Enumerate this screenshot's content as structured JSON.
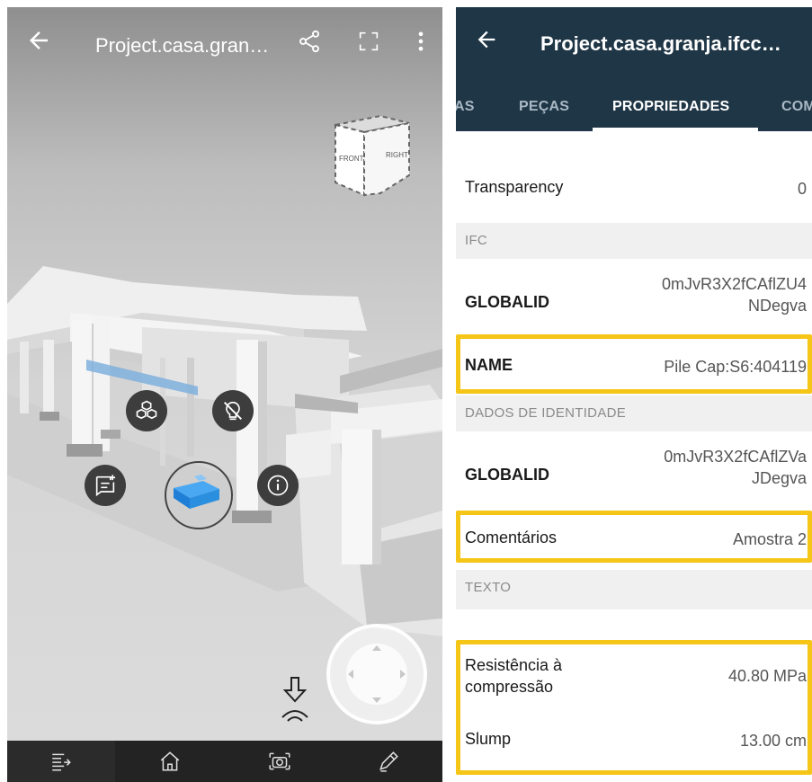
{
  "viewer": {
    "title": "Project.casa.gran…",
    "icons": [
      "back-arrow-icon",
      "share-icon",
      "fullscreen-icon",
      "more-vert-icon"
    ],
    "view_cube": {
      "front": "FRONT",
      "right": "RIGHT"
    },
    "actions": [
      "isolate-icon",
      "hide-icon",
      "comment-icon",
      "info-icon"
    ],
    "bottom_bar": [
      "tree-list-icon",
      "home-icon",
      "camera-icon",
      "pencil-icon"
    ],
    "accent_selected": "#2b8fe0"
  },
  "panel": {
    "title": "Project.casa.granja.ifcc…",
    "tabs": [
      "AS",
      "PEÇAS",
      "PROPRIEDADES",
      "COM"
    ],
    "active_tab": "PROPRIEDADES",
    "header_bg": "#1f3646",
    "highlight_color": "#f5c518",
    "rows": {
      "transparency": {
        "key": "Transparency",
        "value": "0"
      },
      "ifc": {
        "section": "IFC"
      },
      "globalid1": {
        "key": "GLOBALID",
        "value1": "0mJvR3X2fCAflZU4",
        "value2": "NDegva"
      },
      "name": {
        "key": "NAME",
        "value": "Pile Cap:S6:404119"
      },
      "dados": {
        "section": "DADOS DE IDENTIDADE"
      },
      "globalid2": {
        "key": "GLOBALID",
        "value1": "0mJvR3X2fCAflZVa",
        "value2": "JDegva"
      },
      "comentarios": {
        "key": "Comentários",
        "value": "Amostra 2"
      },
      "texto": {
        "section": "TEXTO"
      },
      "resistencia": {
        "key1": "Resistência à",
        "key2": "compressão",
        "value": "40.80 MPa"
      },
      "slump": {
        "key": "Slump",
        "value": "13.00 cm"
      }
    }
  }
}
